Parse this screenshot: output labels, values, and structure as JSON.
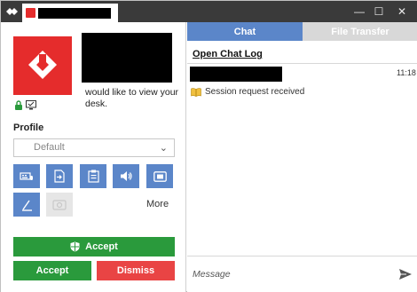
{
  "window": {
    "controls": {
      "minimize": "—",
      "maximize": "☐",
      "close": "✕"
    }
  },
  "colors": {
    "titlebar": "#3a3a3a",
    "brand_red": "#e52c2c",
    "accent_blue": "#5b86c9",
    "accept_green": "#2a9a3c",
    "dismiss_red": "#e94444"
  },
  "session": {
    "request_text": "would like to view your desk."
  },
  "profile": {
    "label": "Profile",
    "selected": "Default"
  },
  "permissions": {
    "items": [
      {
        "icon": "keyboard-mouse-icon",
        "enabled": true
      },
      {
        "icon": "file-transfer-icon",
        "enabled": true
      },
      {
        "icon": "clipboard-icon",
        "enabled": true
      },
      {
        "icon": "audio-icon",
        "enabled": true
      },
      {
        "icon": "screen-record-icon",
        "enabled": true
      },
      {
        "icon": "draw-icon",
        "enabled": true
      },
      {
        "icon": "settings-disabled-icon",
        "enabled": false
      }
    ],
    "more_label": "More"
  },
  "actions": {
    "accept_windows_label": "Accept",
    "accept_label": "Accept",
    "dismiss_label": "Dismiss"
  },
  "chat": {
    "tabs": [
      {
        "label": "Chat",
        "active": true
      },
      {
        "label": "File Transfer",
        "active": false
      }
    ],
    "open_log_label": "Open Chat Log",
    "messages": [
      {
        "time": "11:18",
        "text": "Session request received"
      }
    ],
    "input_placeholder": "Message"
  }
}
